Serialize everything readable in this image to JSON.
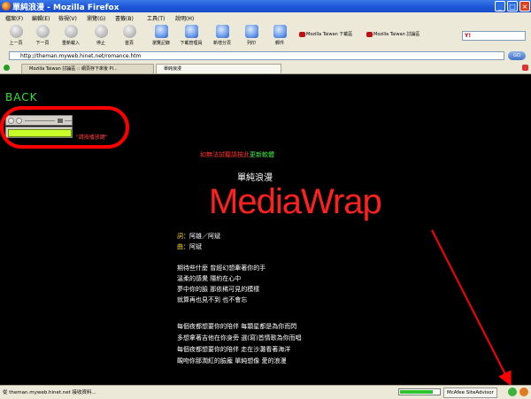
{
  "window": {
    "title": "單純浪漫 - Mozilla Firefox",
    "controls": [
      "_",
      "□",
      "×"
    ]
  },
  "menu": [
    "檔案(F)",
    "編輯(E)",
    "檢視(V)",
    "瀏覽(G)",
    "書籤(B)",
    "工具(T)",
    "說明(H)"
  ],
  "toolbar": {
    "buttons": [
      {
        "label": "上一頁",
        "icon": "back-arrow-icon"
      },
      {
        "label": "下一頁",
        "icon": "forward-arrow-icon"
      },
      {
        "label": "重新載入",
        "icon": "reload-icon"
      },
      {
        "label": "停止",
        "icon": "stop-icon"
      },
      {
        "label": "首頁",
        "icon": "home-icon"
      },
      {
        "label": "瀏覽記錄",
        "icon": "history-icon"
      },
      {
        "label": "下載管理員",
        "icon": "download-icon"
      },
      {
        "label": "新增分頁",
        "icon": "new-tab-icon"
      },
      {
        "label": "列印",
        "icon": "print-icon"
      },
      {
        "label": "郵件",
        "icon": "mail-icon"
      }
    ],
    "bookmarks": [
      "Mozilla Taiwan 下載區",
      "Mozilla Taiwan 討論區"
    ],
    "search_engine": "Y!"
  },
  "address": {
    "url": "http://theman.myweb.hinet.net/romance.htm",
    "go_label": "GO"
  },
  "tabs": [
    {
      "label": "Mozilla Taiwan 討論區 :: 網頁存下來後 Pl...",
      "active": false
    },
    {
      "label": "單純浪漫",
      "active": true
    }
  ],
  "content": {
    "back_label": "BACK",
    "loading_text": "\"請按播放鍵\"",
    "notice": {
      "red": "如無法試聽請按此",
      "green": "更新軟體"
    },
    "song_title": "單純浪漫",
    "annotation": "MediaWrap",
    "credits": [
      {
        "key": "詞",
        "value": "：阿雄／阿斌"
      },
      {
        "key": "曲",
        "value": "：阿斌"
      }
    ],
    "stanzas": [
      [
        "期待些什麼  曾經幻想牽著你的手",
        "溫柔的感覺  隱約在心中",
        "夢中你的臉  那依稀可見的模樣",
        "就算再也見不到  也不會忘"
      ],
      [
        "每個夜都想要你的陪伴  每顆星都是為你而閃",
        "多想拿著吉他在你身旁  選(寫)首情歌為你而唱",
        "每個夜都想要你的陪伴  走在沙灘看著海洋",
        "靦吻你那潤紅的臉龐  單純想像  愛的浪漫"
      ]
    ]
  },
  "status": {
    "text": "從 theman.myweb.hinet.net 接收資料...",
    "progress": 0.85,
    "sitead": "McAfee SiteAdvisor"
  },
  "colors": {
    "annotation_red": "#ff0000",
    "back_green": "#2ee62e",
    "credit_yellow": "#ffde00"
  }
}
